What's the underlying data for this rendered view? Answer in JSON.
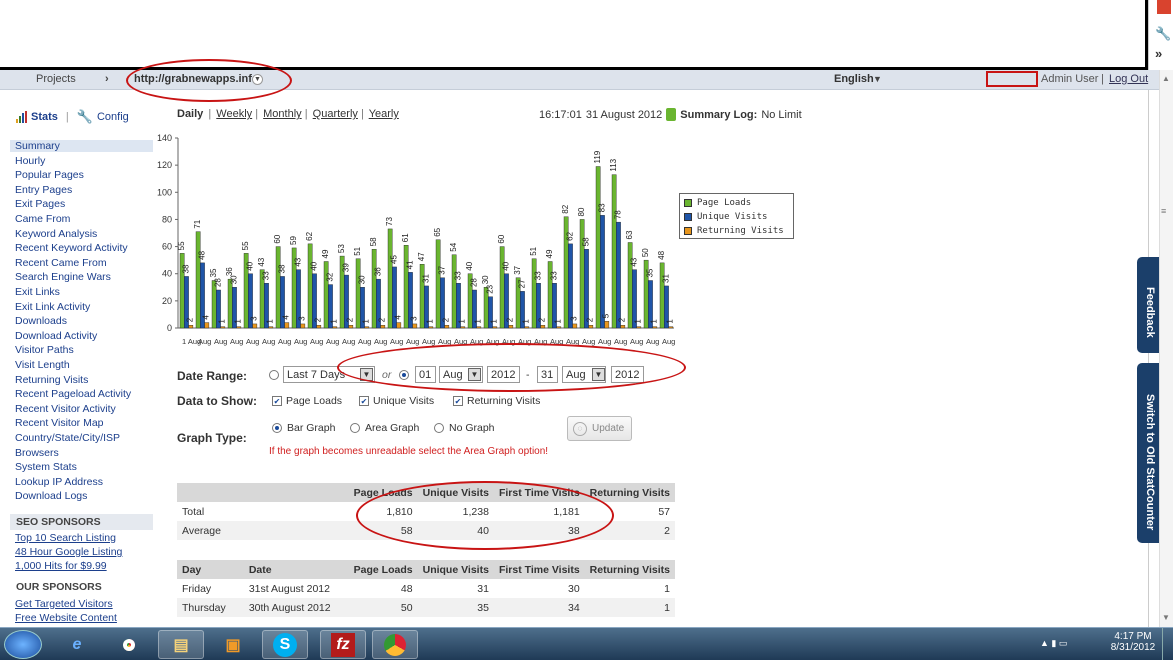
{
  "header": {
    "projects_label": "Projects",
    "projects_arrow": "›",
    "project_url": "http://grabnewapps.info",
    "language": "English",
    "user_label": "Admin User",
    "logout_label": "Log Out"
  },
  "nav": {
    "stats_label": "Stats",
    "config_label": "Config",
    "items": [
      "Summary",
      "Hourly",
      "Popular Pages",
      "Entry Pages",
      "Exit Pages",
      "Came From",
      "Keyword Analysis",
      "Recent Keyword Activity",
      "Recent Came From",
      "Search Engine Wars",
      "Exit Links",
      "Exit Link Activity",
      "Downloads",
      "Download Activity",
      "Visitor Paths",
      "Visit Length",
      "Returning Visits",
      "Recent Pageload Activity",
      "Recent Visitor Activity",
      "Recent Visitor Map",
      "Country/State/City/ISP",
      "Browsers",
      "System Stats",
      "Lookup IP Address",
      "Download Logs"
    ],
    "seo_heading": "SEO SPONSORS",
    "seo_links": [
      "Top 10 Search Listing",
      "48 Hour Google Listing",
      "1,000 Hits for $9.99"
    ],
    "our_heading": "OUR SPONSORS",
    "our_links": [
      "Get Targeted Visitors",
      "Free Website Content"
    ]
  },
  "period": {
    "daily": "Daily",
    "weekly": "Weekly",
    "monthly": "Monthly",
    "quarterly": "Quarterly",
    "yearly": "Yearly",
    "time": "16:17:01",
    "date": "31 August 2012",
    "summary_log_label": "Summary Log:",
    "summary_log_value": "No Limit"
  },
  "chart_data": {
    "type": "bar",
    "ylim": [
      0,
      140
    ],
    "yticks": [
      0,
      20,
      40,
      60,
      80,
      100,
      120,
      140
    ],
    "x_first_label": "1",
    "x_tick_suffix": "Aug",
    "series": [
      {
        "name": "Page Loads",
        "color": "#6ab530",
        "values": [
          55,
          71,
          35,
          36,
          55,
          43,
          60,
          59,
          62,
          49,
          53,
          51,
          58,
          73,
          61,
          47,
          65,
          54,
          40,
          30,
          60,
          37,
          51,
          49,
          82,
          80,
          119,
          113,
          63,
          50,
          48
        ]
      },
      {
        "name": "Unique Visits",
        "color": "#1f55a8",
        "values": [
          38,
          48,
          28,
          30,
          40,
          33,
          38,
          43,
          40,
          32,
          39,
          30,
          36,
          45,
          41,
          31,
          37,
          33,
          28,
          23,
          40,
          27,
          33,
          33,
          62,
          58,
          83,
          78,
          43,
          35,
          31
        ]
      },
      {
        "name": "Returning Visits",
        "color": "#e8961c",
        "values": [
          2,
          4,
          1,
          1,
          3,
          1,
          4,
          3,
          2,
          1,
          2,
          1,
          2,
          4,
          3,
          1,
          2,
          1,
          1,
          1,
          2,
          1,
          2,
          1,
          3,
          2,
          5,
          2,
          1,
          1,
          1
        ]
      }
    ]
  },
  "controls": {
    "date_range_label": "Date Range:",
    "preset": "Last 7 Days",
    "or": "or",
    "from_day": "01",
    "from_month": "Aug",
    "from_year": "2012",
    "dash": "-",
    "to_day": "31",
    "to_month": "Aug",
    "to_year": "2012",
    "data_show_label": "Data to Show:",
    "cb_page_loads": "Page Loads",
    "cb_unique": "Unique Visits",
    "cb_returning": "Returning Visits",
    "graph_type_label": "Graph Type:",
    "rb_bar": "Bar Graph",
    "rb_area": "Area Graph",
    "rb_none": "No Graph",
    "update": "Update",
    "warning": "If the graph becomes unreadable select the Area Graph option!"
  },
  "summary_table": {
    "headers": [
      "",
      "Page Loads",
      "Unique Visits",
      "First Time Visits",
      "Returning Visits"
    ],
    "rows": [
      [
        "Total",
        "1,810",
        "1,238",
        "1,181",
        "57"
      ],
      [
        "Average",
        "58",
        "40",
        "38",
        "2"
      ]
    ]
  },
  "daily_table": {
    "headers": [
      "Day",
      "Date",
      "Page Loads",
      "Unique Visits",
      "First Time Visits",
      "Returning Visits"
    ],
    "rows": [
      [
        "Friday",
        "31st August 2012",
        "48",
        "31",
        "30",
        "1"
      ],
      [
        "Thursday",
        "30th August 2012",
        "50",
        "35",
        "34",
        "1"
      ]
    ]
  },
  "side_tabs": {
    "feedback": "Feedback",
    "old": "Switch to Old StatCounter"
  },
  "taskbar": {
    "time": "4:17 PM",
    "date": "8/31/2012"
  }
}
